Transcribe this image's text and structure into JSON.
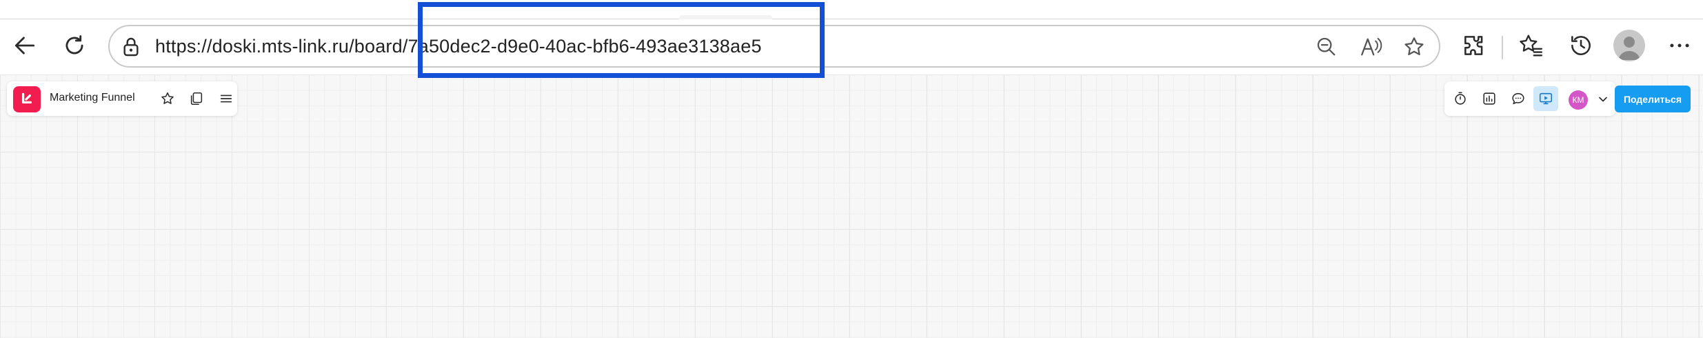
{
  "browser": {
    "url": "https://doski.mts-link.ru/board/7a50dec2-d9e0-40ac-bfb6-493ae3138ae5",
    "icons": [
      "back-icon",
      "refresh-icon",
      "lock-icon",
      "zoom-out-icon",
      "read-aloud-icon",
      "favorite-star-icon",
      "extensions-icon",
      "favorites-icon",
      "history-icon",
      "profile-avatar",
      "more-icon"
    ]
  },
  "board": {
    "title": "Marketing Funnel",
    "user_initials": "КМ",
    "share_label": "Поделиться",
    "accent_color": "#f21d4f",
    "share_color": "#169cf0"
  }
}
